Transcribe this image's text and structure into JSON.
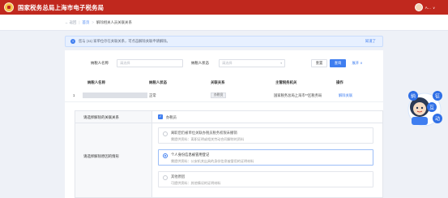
{
  "header": {
    "app_title": "国家税务总局上海市电子税务局",
    "user_name": "A…",
    "user_chevron": "∨"
  },
  "breadcrumb": {
    "back": "← 返回",
    "separator": "|",
    "home": "首页",
    "arrow": ">",
    "current": "解除相关人员关联关系"
  },
  "notice": {
    "icon": "i",
    "text": "您与 (11) 家单位存在关联关系，可点击解除关联申请解除。",
    "link": "知道了"
  },
  "filters": {
    "name_label": "纳税人名称",
    "name_placeholder": "请选择",
    "status_label": "纳税人状态",
    "status_placeholder": "请选择",
    "reset": "重置",
    "query": "查询",
    "expand": "展开 ∨"
  },
  "table": {
    "columns": [
      "纳税人名称",
      "纳税人状态",
      "关联关系",
      "主管税务机关",
      "操作"
    ],
    "rows": [
      {
        "index": "1",
        "status": "正常",
        "relation": "办税员",
        "authority": "国家税务总局上海市**区税务局",
        "action": "解除关联"
      }
    ]
  },
  "subform": {
    "relation_label": "请选择解除的关联关系",
    "relation_option": "办税员",
    "reason_label": "请选择解除原因的情形",
    "reasons": [
      {
        "title": "离职后仍被单位关联办税员税务权限未撤销",
        "desc": "需提供资料：离职证明或相关劳动合同解除的资料",
        "selected": false
      },
      {
        "title": "个人身份信息被冒用登记",
        "desc": "需提供资料：公安机关出具的身份信息被冒用的证明材料",
        "selected": true
      },
      {
        "title": "其他原因",
        "desc": "可提供资料：其他情况的证明材料",
        "selected": false
      }
    ]
  },
  "mascot": {
    "text": "征纳互动"
  },
  "colors": {
    "brand_red": "#c0281e",
    "primary_blue": "#3f7ef0"
  }
}
